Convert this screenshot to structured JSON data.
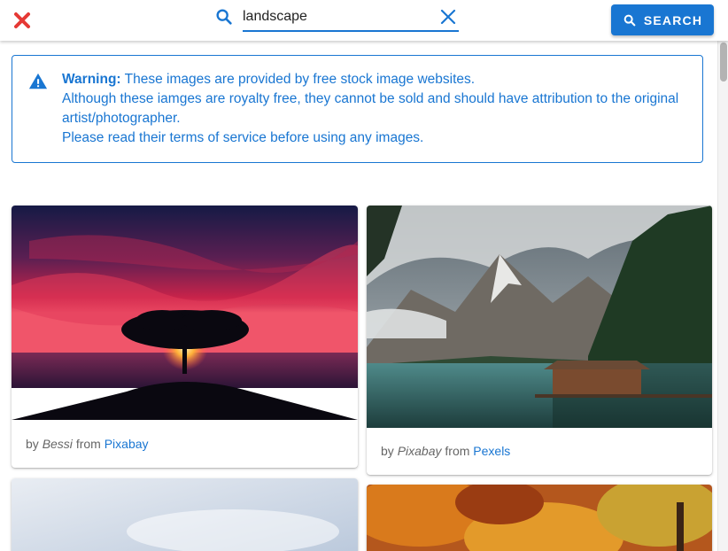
{
  "search": {
    "value": "landscape",
    "button_label": "SEARCH"
  },
  "warning": {
    "title": "Warning:",
    "line1": "These images are provided by free stock image websites.",
    "line2": "Although these iamges are royalty free, they cannot be sold and should have attribution to the original artist/photographer.",
    "line3": "Please read their terms of service before using any images."
  },
  "results": [
    {
      "by": "by",
      "author": "Bessi",
      "from": "from",
      "source": "Pixabay"
    },
    {
      "by": "by",
      "author": "Pixabay",
      "from": "from",
      "source": "Pexels"
    }
  ],
  "colors": {
    "accent": "#1976d2",
    "close": "#e53935"
  },
  "icons": {
    "close": "close-icon",
    "search": "search-icon",
    "clear": "clear-icon",
    "warning": "warning-icon"
  }
}
